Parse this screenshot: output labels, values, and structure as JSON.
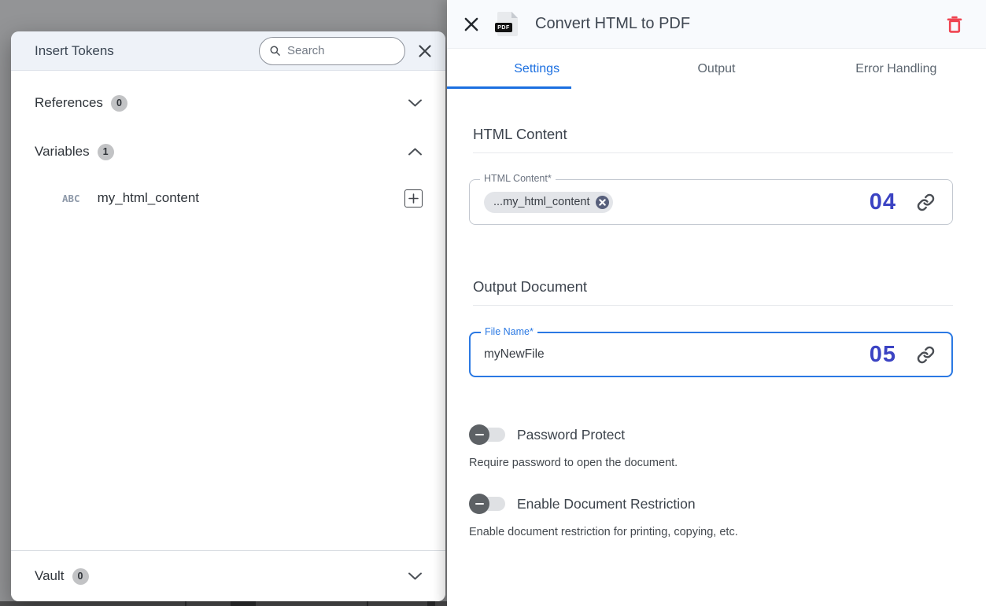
{
  "colors": {
    "accent-blue": "#1b6fe0",
    "focus-blue": "#2b79e3",
    "order-indigo": "#3b43c3",
    "delete-red": "#ef4451",
    "backdrop-gray": "#939496"
  },
  "token_dialog": {
    "title": "Insert Tokens",
    "search": {
      "placeholder": "Search"
    },
    "references": {
      "label": "References",
      "count": "0"
    },
    "variables": {
      "label": "Variables",
      "count": "1"
    },
    "variable_items": [
      {
        "type": "ABC",
        "name": "my_html_content"
      }
    ],
    "vault": {
      "label": "Vault",
      "count": "0"
    }
  },
  "action_panel": {
    "title": "Convert HTML to PDF",
    "file_icon_label": "PDF",
    "tabs": [
      {
        "label": "Settings"
      },
      {
        "label": "Output"
      },
      {
        "label": "Error Handling"
      }
    ],
    "html_content_section": {
      "heading": "HTML Content",
      "field_label": "HTML Content*",
      "token_chip": "...my_html_content",
      "order_number": "04"
    },
    "output_section": {
      "heading": "Output Document",
      "field_label": "File Name*",
      "value": "myNewFile",
      "order_number": "05"
    },
    "toggles": [
      {
        "label": "Password Protect",
        "description": "Require password to open the document."
      },
      {
        "label": "Enable Document Restriction",
        "description": "Enable document restriction for printing, copying, etc."
      }
    ]
  }
}
